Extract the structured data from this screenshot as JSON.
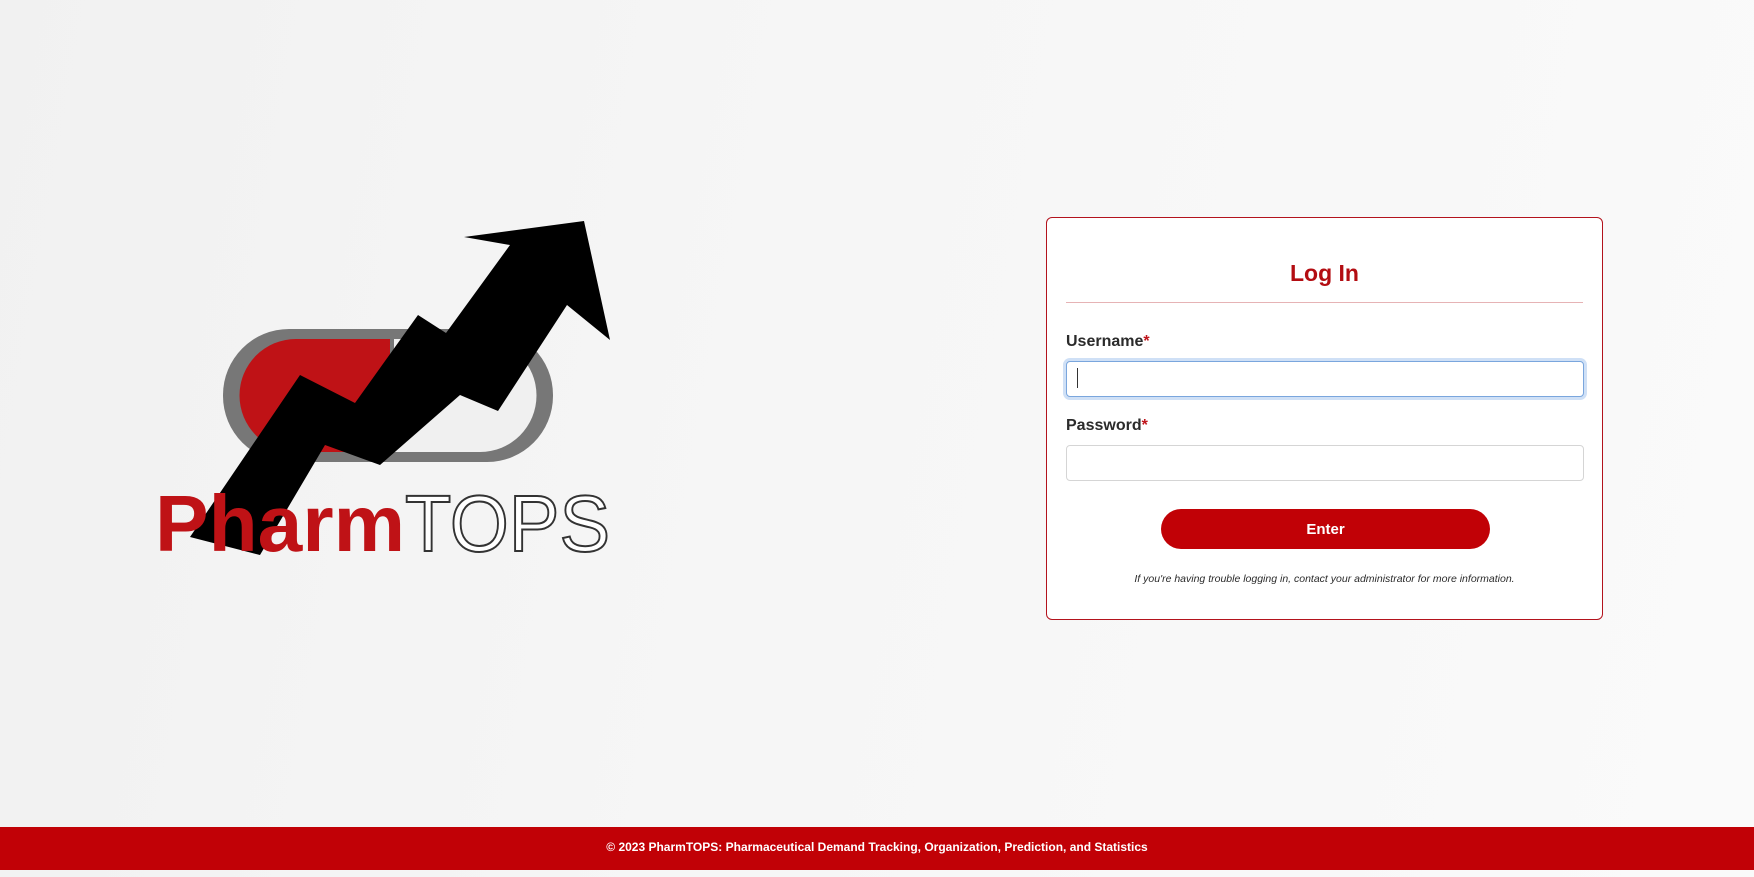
{
  "brand": {
    "logo_text_red": "Pharm",
    "logo_text_outline": "TOPS",
    "logo_icon": "pill-with-rising-arrow-icon",
    "colors": {
      "brand_red": "#c10106",
      "pill_red": "#bf1216",
      "pill_gray": "#777777",
      "arrow": "#000000"
    }
  },
  "login": {
    "title": "Log In",
    "username_label": "Username",
    "password_label": "Password",
    "required_marker": "*",
    "username_value": "",
    "password_value": "",
    "submit_label": "Enter",
    "help_text": "If you're having trouble logging in, contact your administrator for more information."
  },
  "footer": {
    "text": "© 2023 PharmTOPS: Pharmaceutical Demand Tracking, Organization, Prediction, and Statistics"
  }
}
